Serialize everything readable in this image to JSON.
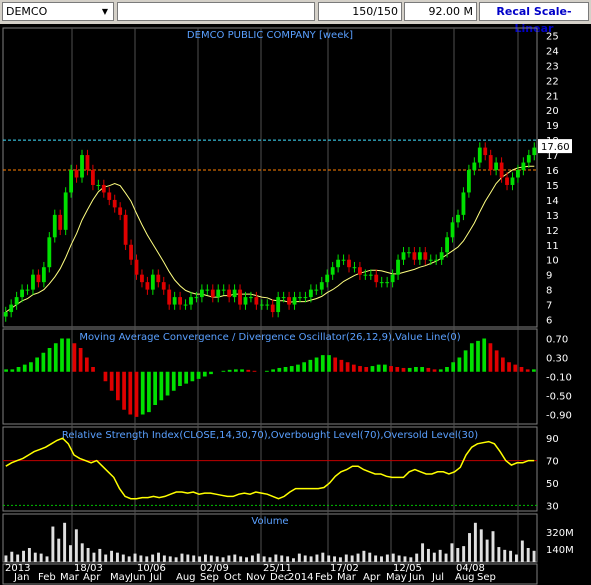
{
  "toolbar": {
    "symbol": "DEMCO",
    "field1": "",
    "field2": "",
    "bars": "150/150",
    "volume": "92.00 M",
    "scale_button": "Recal Scale-Linear"
  },
  "colors": {
    "background": "#000000",
    "up_candle": "#00e000",
    "down_candle": "#e00000",
    "ma_line": "#ffff80",
    "rsi_line": "#ffff00",
    "title_text": "#5aa0ff",
    "resistance_line": "#40e0ff",
    "support_line": "#ff8000",
    "price_marker": "#ffffff"
  },
  "chart_data": [
    {
      "type": "candlestick",
      "title": "DEMCO PUBLIC COMPANY [week]",
      "y_ticks": [
        "25",
        "24",
        "23",
        "22",
        "21",
        "20",
        "19",
        "18",
        "17",
        "16",
        "15",
        "14",
        "13",
        "12",
        "11",
        "10",
        "9",
        "8",
        "7",
        "6"
      ],
      "ylim": [
        5.5,
        25.5
      ],
      "last_price": "17.60",
      "resistance_level": 18,
      "support_level": 16,
      "close": [
        6.5,
        7,
        7.5,
        8,
        8,
        9,
        8.5,
        9.5,
        11.5,
        13,
        12,
        14.5,
        16,
        15.5,
        17,
        16,
        15,
        15,
        14.5,
        14,
        13.5,
        13,
        11,
        10,
        9,
        8.5,
        8,
        9,
        8.5,
        8,
        7,
        7.5,
        7,
        7,
        7.5,
        7.5,
        8,
        8,
        7.5,
        8,
        8,
        7.5,
        8,
        7,
        7.5,
        7.5,
        7,
        7,
        7,
        6.5,
        7.5,
        7.5,
        7,
        7.5,
        7.5,
        7.5,
        8,
        8,
        8.5,
        9,
        9.5,
        10,
        10,
        9.5,
        9.5,
        9,
        9,
        9,
        8.5,
        8.5,
        8.5,
        9,
        10,
        10.5,
        10.5,
        10,
        10.5,
        10,
        10,
        10,
        10.5,
        11.5,
        12.5,
        13,
        14.5,
        16,
        16.5,
        17.5,
        17,
        16,
        16.5,
        15.5,
        15,
        15.5,
        16,
        16.5,
        17,
        17.5
      ],
      "ma_label": "yellow moving average line"
    },
    {
      "type": "bar",
      "title": "Moving Average Convergence / Divergence Oscillator(26,12,9),Value Line(0)",
      "y_ticks": [
        "0.70",
        "0.30",
        "-0.10",
        "-0.50",
        "-0.90"
      ],
      "ylim": [
        -1.1,
        0.9
      ],
      "values": [
        0.05,
        0.05,
        0.1,
        0.15,
        0.2,
        0.3,
        0.4,
        0.5,
        0.6,
        0.7,
        0.7,
        0.6,
        0.5,
        0.3,
        0.1,
        0,
        -0.2,
        -0.4,
        -0.6,
        -0.8,
        -0.9,
        -0.95,
        -0.9,
        -0.85,
        -0.7,
        -0.6,
        -0.5,
        -0.4,
        -0.3,
        -0.25,
        -0.2,
        -0.15,
        -0.1,
        -0.05,
        0,
        0.02,
        0.04,
        0.05,
        0.05,
        0.04,
        0.02,
        0,
        0.02,
        0.05,
        0.08,
        0.1,
        0.12,
        0.15,
        0.2,
        0.25,
        0.3,
        0.35,
        0.35,
        0.3,
        0.25,
        0.2,
        0.15,
        0.12,
        0.1,
        0.12,
        0.15,
        0.15,
        0.12,
        0.1,
        0.08,
        0.08,
        0.1,
        0.1,
        0.08,
        0.05,
        0.05,
        0.1,
        0.2,
        0.3,
        0.45,
        0.6,
        0.65,
        0.7,
        0.6,
        0.45,
        0.3,
        0.2,
        0.15,
        0.1,
        0.05,
        0.05
      ]
    },
    {
      "type": "line",
      "title": "Relative Strength Index(CLOSE,14,30,70),Overbought Level(70),Oversold Level(30)",
      "y_ticks": [
        "90",
        "70",
        "50",
        "30"
      ],
      "ylim": [
        25,
        100
      ],
      "overbought": 70,
      "oversold": 30,
      "values": [
        65,
        68,
        70,
        72,
        75,
        78,
        80,
        82,
        85,
        88,
        90,
        85,
        75,
        72,
        70,
        68,
        70,
        65,
        60,
        55,
        45,
        38,
        36,
        36,
        37,
        37,
        38,
        37,
        38,
        40,
        42,
        42,
        41,
        42,
        40,
        41,
        41,
        40,
        39,
        38,
        38,
        40,
        41,
        40,
        42,
        41,
        40,
        38,
        36,
        38,
        42,
        45,
        45,
        45,
        45,
        45,
        46,
        50,
        56,
        60,
        62,
        65,
        65,
        62,
        60,
        58,
        58,
        56,
        55,
        55,
        55,
        60,
        62,
        60,
        58,
        58,
        60,
        60,
        58,
        60,
        64,
        75,
        82,
        85,
        86,
        87,
        85,
        78,
        70,
        66,
        68,
        68,
        70,
        70
      ]
    },
    {
      "type": "bar",
      "title": "Volume",
      "y_ticks": [
        "320M",
        "140M"
      ],
      "x_ticks": [
        "2013",
        "18/03",
        "10/06",
        "02/09",
        "25/11",
        "17/02",
        "12/05",
        "04/08"
      ],
      "months": [
        "Jan",
        "Feb",
        "Mar",
        "Apr",
        "May",
        "Jun",
        "Jul",
        "Aug",
        "Sep",
        "Oct",
        "Nov",
        "Dec",
        "2014",
        "Feb",
        "Mar",
        "Apr",
        "May",
        "Jun",
        "Jul",
        "Aug",
        "Sep"
      ],
      "values": [
        70,
        110,
        80,
        120,
        150,
        100,
        90,
        60,
        380,
        250,
        420,
        180,
        350,
        200,
        150,
        100,
        140,
        80,
        120,
        100,
        80,
        60,
        90,
        70,
        60,
        80,
        100,
        70,
        60,
        50,
        90,
        80,
        70,
        60,
        80,
        70,
        60,
        50,
        70,
        80,
        60,
        50,
        70,
        90,
        60,
        50,
        80,
        70,
        60,
        40,
        90,
        70,
        60,
        80,
        100,
        70,
        60,
        50,
        80,
        70,
        90,
        120,
        100,
        70,
        60,
        80,
        90,
        70,
        60,
        50,
        90,
        200,
        140,
        100,
        130,
        90,
        200,
        150,
        170,
        310,
        420,
        350,
        240,
        330,
        160,
        130,
        120,
        80,
        230,
        150,
        120
      ]
    }
  ]
}
